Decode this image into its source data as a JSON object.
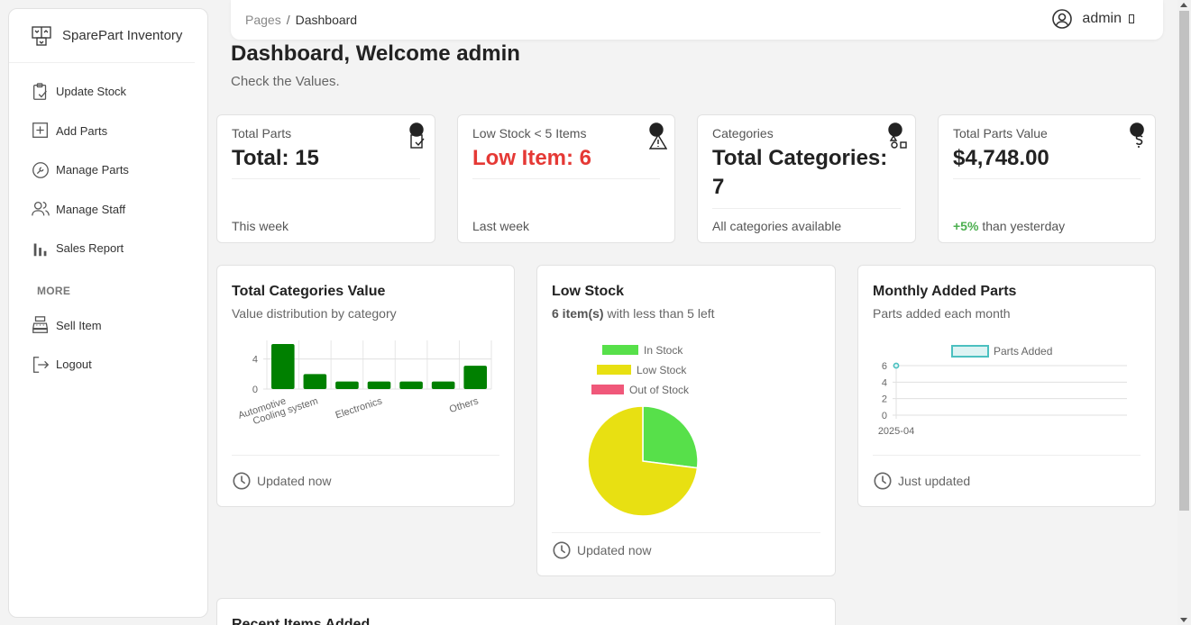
{
  "brand": {
    "name": "SparePart Inventory"
  },
  "sidebar": {
    "items": [
      {
        "label": "Update Stock",
        "icon": "clipboard-check-icon"
      },
      {
        "label": "Add Parts",
        "icon": "plus-square-icon"
      },
      {
        "label": "Manage Parts",
        "icon": "wrench-icon"
      },
      {
        "label": "Manage Staff",
        "icon": "users-icon"
      },
      {
        "label": "Sales Report",
        "icon": "bar-chart-icon"
      }
    ],
    "section_label": "MORE",
    "more_items": [
      {
        "label": "Sell Item",
        "icon": "cash-register-icon"
      },
      {
        "label": "Logout",
        "icon": "logout-icon"
      }
    ]
  },
  "topbar": {
    "breadcrumb": {
      "root": "Pages",
      "separator": "/",
      "current": "Dashboard"
    },
    "user": {
      "name": "admin",
      "icon": "user-circle-icon"
    }
  },
  "page": {
    "title": "Dashboard, Welcome admin",
    "subtitle": "Check the Values."
  },
  "stats": [
    {
      "label": "Total Parts",
      "value": "Total: 15",
      "footer": "This week",
      "icon": "clipboard-check-icon"
    },
    {
      "label": "Low Stock < 5 Items",
      "value": "Low Item: 6",
      "footer": "Last week",
      "icon": "warning-icon",
      "value_color": "#e53935"
    },
    {
      "label": "Categories",
      "value": "Total Categories: 7",
      "footer": "All categories available",
      "icon": "shapes-icon"
    },
    {
      "label": "Total Parts Value",
      "value": "$4,748.00",
      "footer_highlight": "+5%",
      "footer": "than yesterday",
      "icon": "dollar-icon",
      "highlight_color": "#4caf50"
    }
  ],
  "cards": {
    "categories": {
      "title": "Total Categories Value",
      "subtitle": "Value distribution by category",
      "footer": "Updated now"
    },
    "low_stock": {
      "title": "Low Stock",
      "subtitle_bold": "6 item(s)",
      "subtitle_rest": "with less than 5 left",
      "footer": "Updated now"
    },
    "monthly": {
      "title": "Monthly Added Parts",
      "subtitle": "Parts added each month",
      "footer": "Just updated"
    },
    "recent": {
      "title": "Recent Items Added"
    }
  },
  "chart_data": [
    {
      "type": "bar",
      "categories": [
        "Automotive",
        "Cooling system",
        "",
        "Electronics",
        "",
        "",
        "Others"
      ],
      "values": [
        6,
        2,
        1,
        1,
        1,
        1,
        3.1
      ],
      "yticks": [
        0,
        4
      ],
      "ylim": [
        0,
        6
      ],
      "color": "#008000"
    },
    {
      "type": "pie",
      "labels": [
        "In Stock",
        "Low Stock",
        "Out of Stock"
      ],
      "values": [
        27,
        73,
        0
      ],
      "colors": [
        "#57e04a",
        "#e8e012",
        "#f0587a"
      ],
      "legend": "top"
    },
    {
      "type": "line",
      "x": [
        "2025-04"
      ],
      "series": [
        {
          "name": "Parts Added",
          "values": [
            6
          ]
        }
      ],
      "yticks": [
        0,
        2,
        4,
        6
      ],
      "ylim": [
        0,
        6
      ],
      "color": "#4bc0c0"
    }
  ]
}
